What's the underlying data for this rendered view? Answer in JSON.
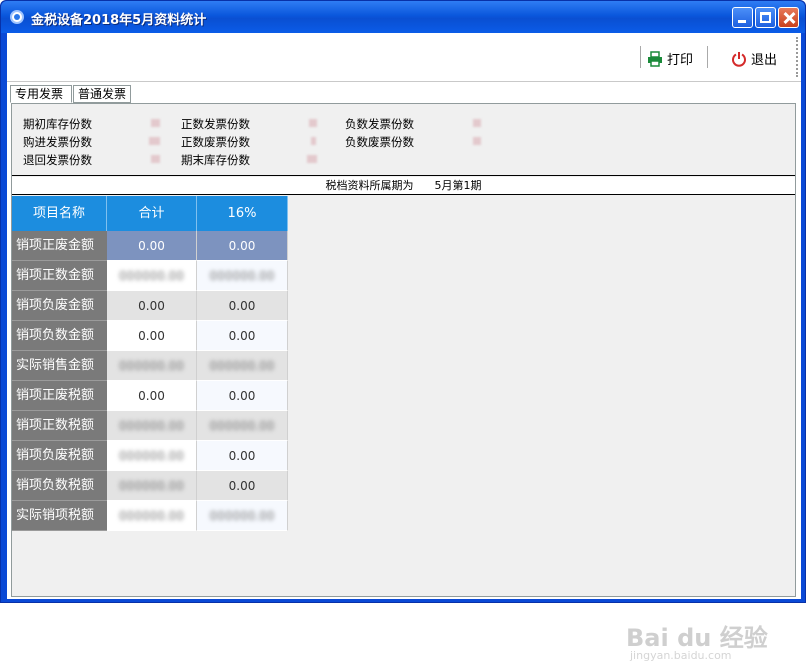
{
  "window": {
    "title": "金税设备2018年5月资料统计"
  },
  "toolbar": {
    "print_label": "打印",
    "exit_label": "退出"
  },
  "tabs": [
    {
      "label": "专用发票",
      "active": true
    },
    {
      "label": "普通发票",
      "active": false
    }
  ],
  "stats": {
    "col1": [
      "期初库存份数",
      "购进发票份数",
      "退回发票份数"
    ],
    "col2": [
      "正数发票份数",
      "正数废票份数",
      "期末库存份数"
    ],
    "col3": [
      "负数发票份数",
      "负数废票份数"
    ]
  },
  "period": {
    "label": "税档资料所属期为",
    "value": "5月第1期"
  },
  "table": {
    "headers": [
      "项目名称",
      "合计",
      "16%"
    ],
    "rows": [
      {
        "name": "销项正废金额",
        "total": "0.00",
        "rate16": "0.00",
        "blur_total": false,
        "blur_rate": false
      },
      {
        "name": "销项正数金额",
        "total": "",
        "rate16": "",
        "blur_total": true,
        "blur_rate": true
      },
      {
        "name": "销项负废金额",
        "total": "0.00",
        "rate16": "0.00",
        "blur_total": false,
        "blur_rate": false
      },
      {
        "name": "销项负数金额",
        "total": "0.00",
        "rate16": "0.00",
        "blur_total": false,
        "blur_rate": false
      },
      {
        "name": "实际销售金额",
        "total": "",
        "rate16": "",
        "blur_total": true,
        "blur_rate": true
      },
      {
        "name": "销项正废税额",
        "total": "0.00",
        "rate16": "0.00",
        "blur_total": false,
        "blur_rate": false
      },
      {
        "name": "销项正数税额",
        "total": "",
        "rate16": "",
        "blur_total": true,
        "blur_rate": true
      },
      {
        "name": "销项负废税额",
        "total": "",
        "rate16": "0.00",
        "blur_total": true,
        "blur_rate": false
      },
      {
        "name": "销项负数税额",
        "total": "",
        "rate16": "0.00",
        "blur_total": true,
        "blur_rate": false
      },
      {
        "name": "实际销项税额",
        "total": "",
        "rate16": "",
        "blur_total": true,
        "blur_rate": true
      }
    ]
  },
  "watermark": {
    "text": "Bai du 经验",
    "url": "jingyan.baidu.com"
  },
  "colors": {
    "title_bar": "#0a57dc",
    "header": "#1c8ddf",
    "selected_row": "#7d93bf"
  }
}
